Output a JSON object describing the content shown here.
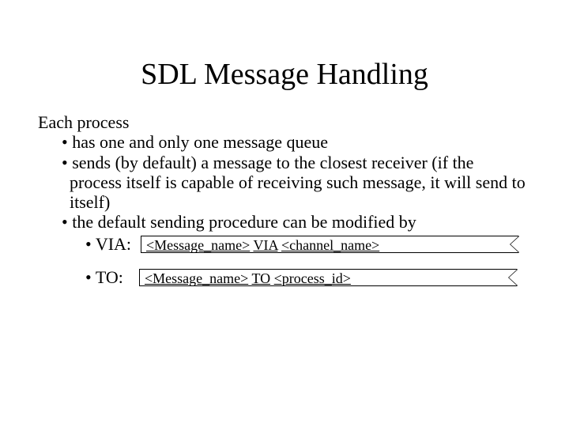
{
  "title": "SDL Message Handling",
  "intro": "Each process",
  "bullets": {
    "b1": "has one and only one message queue",
    "b2": "sends (by default) a message to the closest receiver (if the process itself is capable of receiving such message, it will send to itself)",
    "b3": "the default sending procedure can be modified by"
  },
  "via": {
    "label": "VIA:",
    "msg": "<Message_name>",
    "kw": "VIA",
    "arg": "<channel_name>"
  },
  "to": {
    "label": "TO:",
    "msg": "<Message_name>",
    "kw": "TO",
    "arg": "<process_id>"
  }
}
